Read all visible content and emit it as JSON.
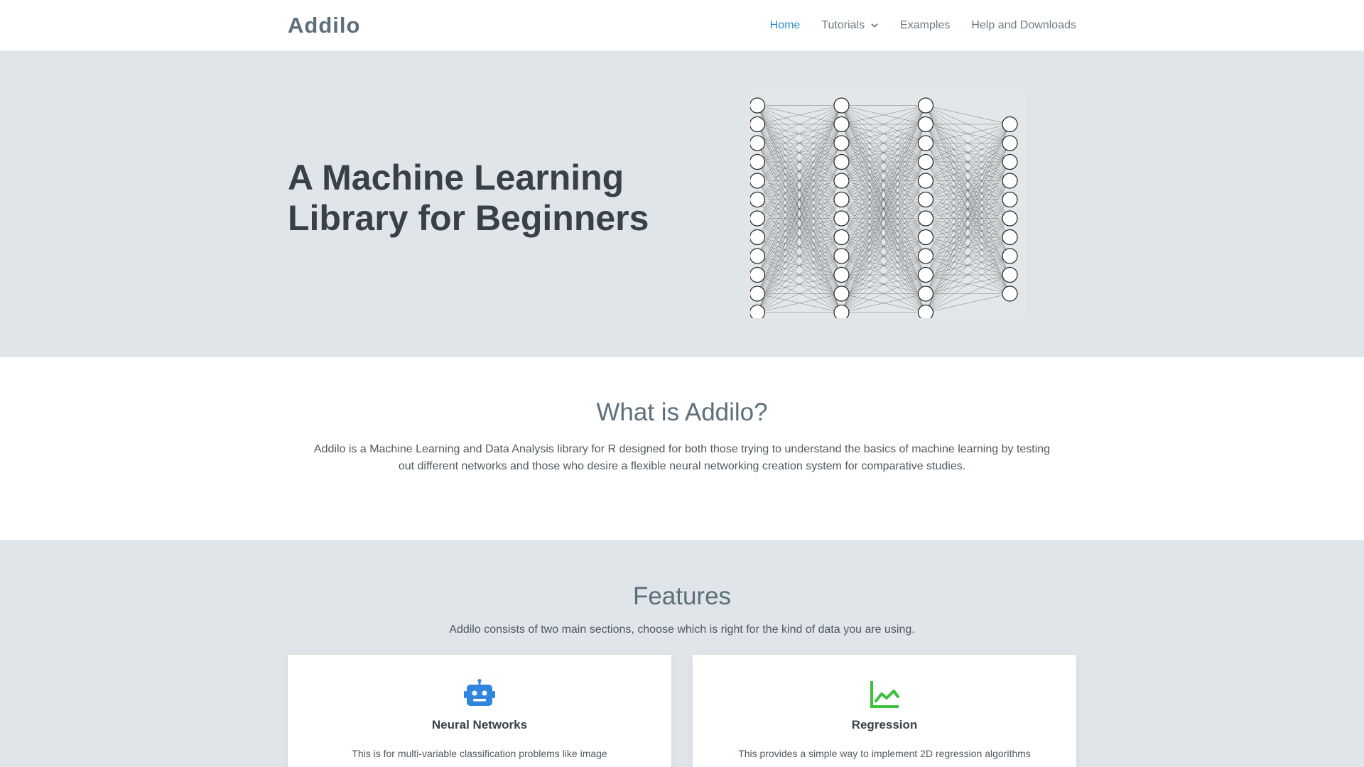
{
  "brand": "Addilo",
  "nav": {
    "items": [
      {
        "label": "Home",
        "active": true
      },
      {
        "label": "Tutorials",
        "has_dropdown": true
      },
      {
        "label": "Examples"
      },
      {
        "label": "Help and Downloads"
      }
    ]
  },
  "hero": {
    "title_line1": "A Machine Learning",
    "title_line2": "Library for Beginners",
    "network_layers": [
      12,
      12,
      12,
      10
    ]
  },
  "about": {
    "title": "What is Addilo?",
    "text_line1": "Addilo is a Machine Learning and Data Analysis library for R designed for both those trying to understand the basics of machine learning by testing",
    "text_line2": "out different networks and those who desire a flexible neural networking creation system for comparative studies."
  },
  "features": {
    "title": "Features",
    "subtitle": "Addilo consists of two main sections, choose which is right for the kind of data you are using.",
    "cards": [
      {
        "icon": "robot-icon",
        "title": "Neural Networks",
        "text": "This is for multi-variable classification problems like image",
        "color": "#2e86de"
      },
      {
        "icon": "chart-line-icon",
        "title": "Regression",
        "text": "This provides a simple way to implement 2D regression algorithms",
        "color": "#3cc13b"
      }
    ]
  },
  "colors": {
    "accent": "#2e8fd6",
    "hero_bg": "#dfe5e9",
    "heading": "#384246"
  }
}
